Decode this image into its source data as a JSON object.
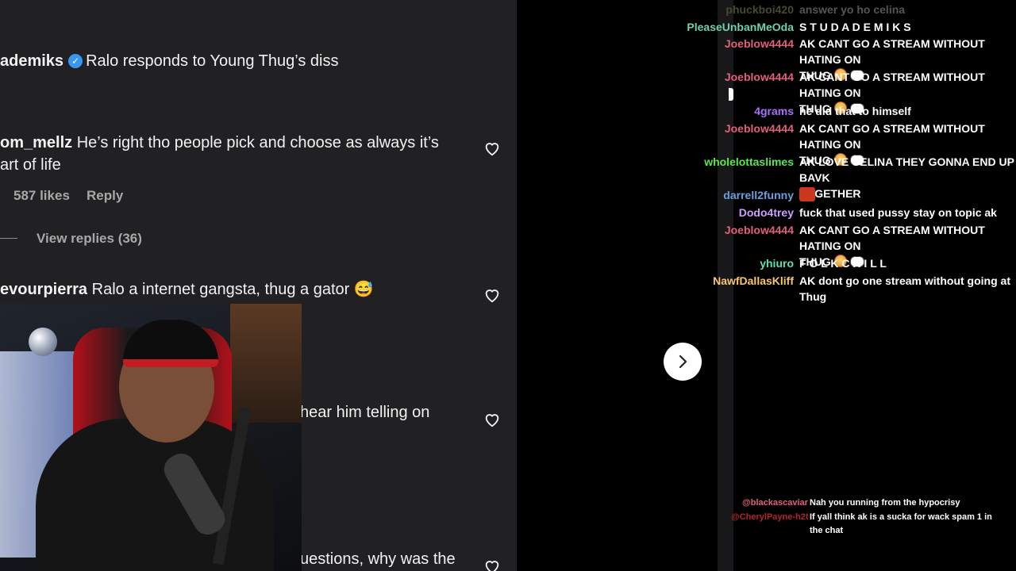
{
  "instagram": {
    "post_header": {
      "username": "ademiks",
      "caption": "Ralo responds to Young Thug’s diss"
    },
    "comments": [
      {
        "username": "om_mellz",
        "line1": "He’s right tho people pick and choose as always it’s",
        "line2": "art of life",
        "likes": "587 likes",
        "reply": "Reply",
        "view_replies": "View replies (36)"
      },
      {
        "username": "evourpierra",
        "text": "Ralo a internet gangsta, thug a gator",
        "emoji": "😅"
      },
      {
        "text": "hear him telling on"
      },
      {
        "text": "uestions, why was the"
      }
    ]
  },
  "overlay": {
    "next_arrow": "chevron-right-icon"
  },
  "chat": {
    "messages": [
      {
        "user": "phuckboi420",
        "color": "#4a4a2a",
        "text": "answer yo ho celina"
      },
      {
        "user": "PleaseUnbanMeOda",
        "color": "#6fcfae",
        "text": "S T U D A D E M I K S"
      },
      {
        "user": "Joeblow4444",
        "color": "#e0607c",
        "text": "AK CANT GO A STREAM WITHOUT HATING ON",
        "cont": "THUG"
      },
      {
        "user": "Joeblow4444",
        "color": "#e0607c",
        "text": "AK CANT GO A STREAM WITHOUT HATING ON",
        "cont": "THUG"
      },
      {
        "user": "4grams",
        "color": "#a970ff",
        "text": "he did that to himself"
      },
      {
        "user": "Joeblow4444",
        "color": "#e0607c",
        "text": "AK CANT GO A STREAM WITHOUT HATING ON",
        "cont": "THUG"
      },
      {
        "user": "wholelottaslimes",
        "color": "#58e84b",
        "text": "AK LOVE CELINA THEY GONNA END UP BAVK",
        "cont": "TOGETHER"
      },
      {
        "user": "darrell2funny",
        "color": "#6c9fe0",
        "text": ""
      },
      {
        "user": "Dodo4trey",
        "color": "#c9a0ff",
        "text": "fuck that used pussy stay on topic ak"
      },
      {
        "user": "Joeblow4444",
        "color": "#e0607c",
        "text": "AK CANT GO A STREAM WITHOUT HATING ON",
        "cont": "THUG"
      },
      {
        "user": "yhiuro",
        "color": "#5de0b0",
        "text": "F O L K C H I L L"
      },
      {
        "user": "NawfDallasKliff",
        "color": "#f5c66e",
        "text": "AK dont go one stream without going at Thug"
      }
    ],
    "lower": [
      {
        "user": "@blackascaviar",
        "color": "#e0607c",
        "text": "Nah you running from the hypocrisy"
      },
      {
        "user": "@CherylPayne-h2t",
        "color": "#b5242c",
        "text": "If yall think ak is a sucka for wack spam 1 in",
        "cont": "the chat"
      }
    ]
  }
}
